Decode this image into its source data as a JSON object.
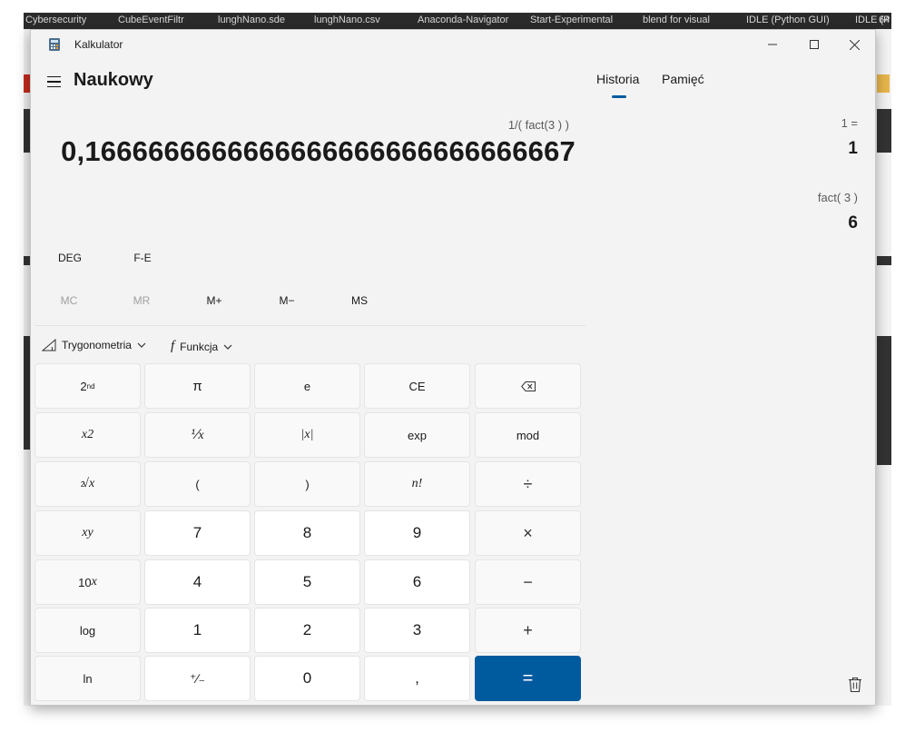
{
  "background": {
    "taskbar_items": [
      "Cybersecurity",
      "CubeEventFiltr",
      "lunghNano.sde",
      "lunghNano.csv",
      "Anaconda-Navigator",
      "Start-Experimental",
      "blend for visual",
      "IDLE (Python GUI)",
      "IDLE (P",
      "64"
    ]
  },
  "window": {
    "title": "Kalkulator",
    "minimize_icon": "minimize-icon",
    "maximize_icon": "maximize-icon",
    "close_icon": "close-icon"
  },
  "header": {
    "menu_icon": "hamburger-menu-icon",
    "mode_title": "Naukowy"
  },
  "display": {
    "expression": "1/( fact(3 ) )",
    "value": "0,1666666666666666666666666666667"
  },
  "toolbar": {
    "deg": "DEG",
    "fe": "F-E"
  },
  "memory": {
    "mc": "MC",
    "mr": "MR",
    "mplus": "M+",
    "mminus": "M−",
    "ms": "MS"
  },
  "dropdowns": {
    "trig": "Trygonometria",
    "func": "Funkcja",
    "func_icon_glyph": "f"
  },
  "keys": {
    "second": "2",
    "second_sup": "nd",
    "pi": "π",
    "e": "e",
    "ce": "CE",
    "backspace_icon": "backspace-icon",
    "square_base": "x",
    "square_sup": "2",
    "reciprocal": "⅟x",
    "abs": "|x|",
    "exp": "exp",
    "mod": "mod",
    "root_index": "2",
    "root_base": "√x",
    "lparen": "(",
    "rparen": ")",
    "fact": "n!",
    "divide": "÷",
    "pow_base": "x",
    "pow_sup": "y",
    "seven": "7",
    "eight": "8",
    "nine": "9",
    "multiply": "×",
    "ten_base": "10",
    "ten_sup": "x",
    "four": "4",
    "five": "5",
    "six": "6",
    "minus": "−",
    "log": "log",
    "one": "1",
    "two": "2",
    "three": "3",
    "plus": "+",
    "ln": "ln",
    "negate": "⁺∕₋",
    "zero": "0",
    "decimal": ",",
    "equals": "="
  },
  "panel": {
    "tab_history": "Historia",
    "tab_memory": "Pamięć",
    "history": [
      {
        "expression": "1 =",
        "result": "1"
      },
      {
        "expression": "fact( 3 )",
        "result": "6"
      }
    ],
    "trash_icon": "trash-icon"
  },
  "colors": {
    "accent": "#005a9e",
    "window_bg": "#f3f3f3"
  }
}
